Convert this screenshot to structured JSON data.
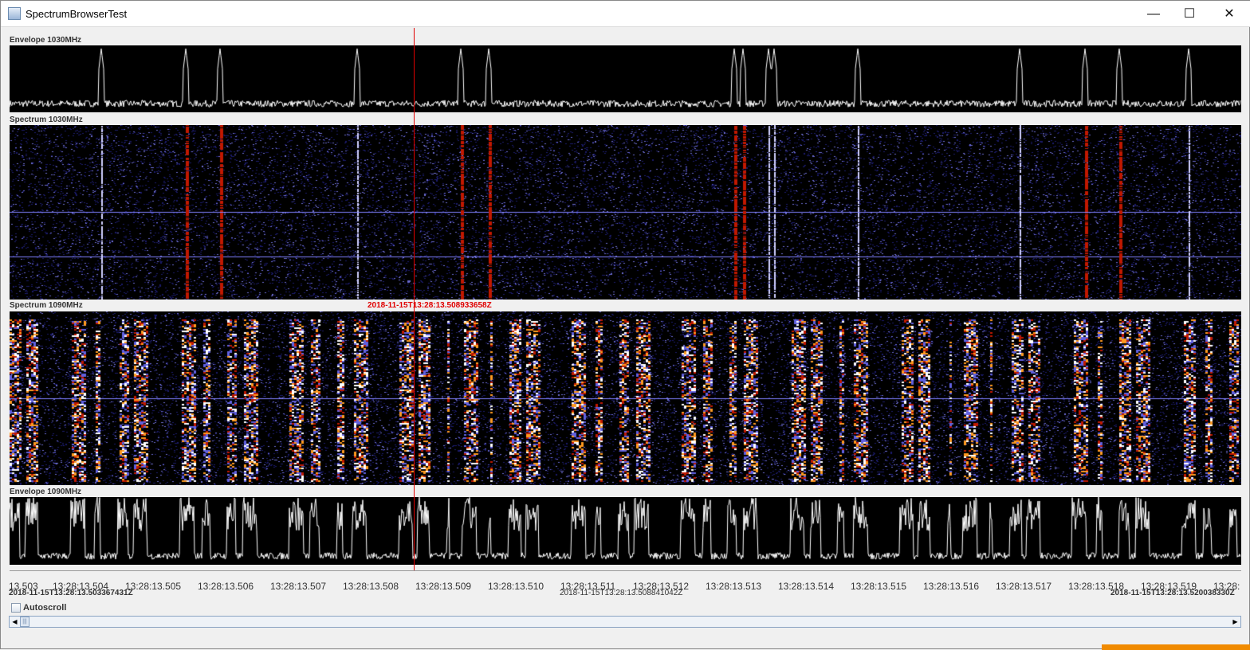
{
  "window": {
    "title": "SpectrumBrowserTest",
    "minimize": "—",
    "maximize": "☐",
    "close": "✕"
  },
  "panels": {
    "env1030": "Envelope 1030MHz",
    "spec1030": "Spectrum 1030MHz",
    "spec1090": "Spectrum 1090MHz",
    "env1090": "Envelope 1090MHz"
  },
  "cursor": {
    "label": "2018-11-15T13:28:13.508933658Z",
    "color": "#e00000"
  },
  "axis": {
    "ticks": [
      "13.503",
      "13:28:13.504",
      "13:28:13.505",
      "13:28:13.506",
      "13:28:13.507",
      "13:28:13.508",
      "13:28:13.509",
      "13:28:13.510",
      "13:28:13.511",
      "13:28:13.512",
      "13:28:13.513",
      "13:28:13.514",
      "13:28:13.515",
      "13:28:13.516",
      "13:28:13.517",
      "13:28:13.518",
      "13:28:13.519",
      "13:28:"
    ]
  },
  "timestamps": {
    "start": "2018-11-15T13:28:13.503367431Z",
    "center": "2018-11-15T13:28:13.508841042Z",
    "end": "2018-11-15T13:28:13.520038330Z"
  },
  "autoscroll": {
    "label": "Autoscroll",
    "checked": false
  },
  "scrollbar": {
    "left": "◀",
    "right": "▶",
    "thumb": "|||"
  }
}
